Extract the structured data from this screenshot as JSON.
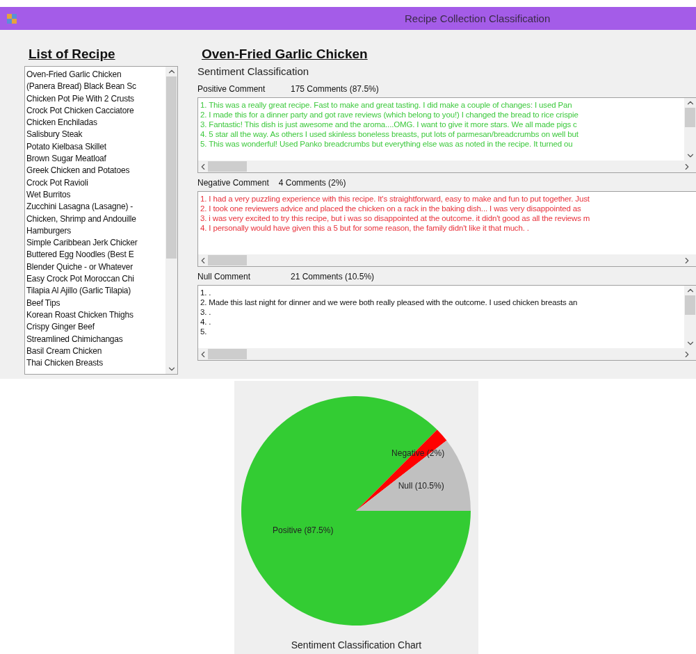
{
  "window": {
    "title": "Recipe Collection Classification"
  },
  "recipe_list": {
    "heading": "List of Recipe",
    "items": [
      "Oven-Fried Garlic Chicken",
      "(Panera Bread) Black Bean Sc",
      "Chicken Pot Pie With 2 Crusts",
      "Crock Pot Chicken Cacciatore",
      "Chicken Enchiladas",
      "Salisbury Steak",
      "Potato Kielbasa Skillet",
      "Brown Sugar Meatloaf",
      "Greek Chicken and Potatoes",
      "Crock Pot Ravioli",
      "Wet Burritos",
      "Zucchini Lasagna (Lasagne) -",
      "Chicken, Shrimp and Andouille",
      "Hamburgers",
      "Simple Caribbean Jerk Chicker",
      "Buttered Egg Noodles (Best E",
      "Blender Quiche - or Whatever",
      "Easy Crock Pot Moroccan Chi",
      "Tilapia Al Ajillo (Garlic Tilapia)",
      "Beef Tips",
      "Korean Roast Chicken Thighs",
      "Crispy Ginger Beef",
      "Streamlined Chimichangas",
      "Basil Cream Chicken",
      "Thai Chicken Breasts"
    ]
  },
  "recipe": {
    "title": "Oven-Fried Garlic Chicken",
    "subtitle": "Sentiment Classification"
  },
  "sections": [
    {
      "label": "Positive Comment",
      "count": "175 Comments  (87.5%)",
      "color": "#3cc83c",
      "vertical_scroll": true,
      "comments": [
        "1. This was a really great recipe.  Fast to make and great tasting.  I did make a couple of changes:  I used Pan",
        "2. I made this for a dinner party and got rave reviews (which belong to you!)  I changed the bread to rice crispie",
        "3. Fantastic!  This dish is just awesome and the aroma....OMG.  I want to give it more stars.  We all made pigs c",
        "4. 5 star all the way.  As others I used skinless boneless breasts, put lots of parmesan/breadcrumbs on well but",
        "5. This was wonderful!  Used Panko breadcrumbs but everything else was as noted in the recipe.  It turned ou"
      ]
    },
    {
      "label": "Negative Comment",
      "count": "4 Comments  (2%)",
      "color": "#e8303a",
      "vertical_scroll": false,
      "comments": [
        "1. I had a very puzzling experience with this recipe. It's straightforward, easy to make and fun to put together. Just",
        "2. I took one reviewers advice and placed the chicken on a rack in the baking dish... I was very disappointed as",
        "3. i was very excited to try this recipe, but i was so disappointed at the outcome. it didn't good as all the reviews m",
        "4. I personally would have given this a 5 but for some reason, the family didn't like it that much. ."
      ]
    },
    {
      "label": "Null Comment",
      "count": "21 Comments  (10.5%)",
      "color": "#111111",
      "vertical_scroll": true,
      "comments": [
        "1.  .",
        "2. Made this last night for dinner and we were both really pleased with the outcome.  I used chicken breasts an",
        "3.  .",
        "4.  .",
        "5."
      ]
    }
  ],
  "chart_data": {
    "type": "pie",
    "title": "Sentiment Classification Chart",
    "categories": [
      "Positive (87.5%)",
      "Negative (2%)",
      "Null (10.5%)"
    ],
    "values": [
      87.5,
      2,
      10.5
    ],
    "colors": [
      "#33cc33",
      "#ff0000",
      "#c0c0c0"
    ]
  }
}
